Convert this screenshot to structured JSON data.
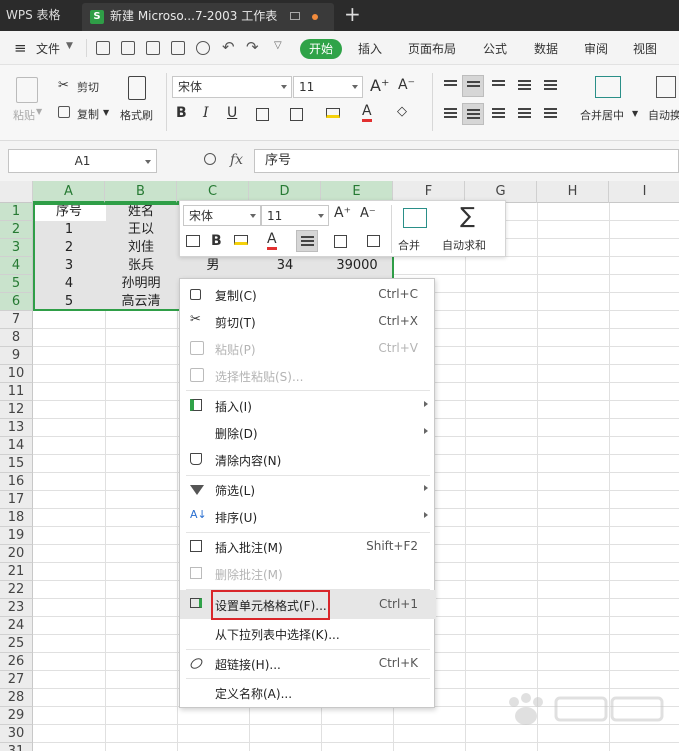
{
  "titlebar": {
    "app_label": "WPS 表格",
    "doc_tab": "新建 Microso...7-2003 工作表",
    "new_tab": "+"
  },
  "menubar": {
    "file": "文件",
    "tabs": [
      "开始",
      "插入",
      "页面布局",
      "公式",
      "数据",
      "审阅",
      "视图"
    ]
  },
  "ribbon": {
    "paste": "粘贴",
    "cut": "剪切",
    "copy": "复制",
    "format_painter": "格式刷",
    "font_name": "宋体",
    "font_size": "11",
    "merge_center": "合并居中",
    "auto_sum": "自动换"
  },
  "formula_bar": {
    "name_box": "A1",
    "fx": "fx",
    "formula": "序号"
  },
  "grid": {
    "columns": [
      "A",
      "B",
      "C",
      "D",
      "E",
      "F",
      "G",
      "H",
      "I"
    ],
    "rows": [
      "1",
      "2",
      "3",
      "4",
      "5",
      "6",
      "7",
      "8",
      "9",
      "10",
      "11",
      "12",
      "13",
      "14",
      "15",
      "16",
      "17",
      "18",
      "19",
      "20",
      "21",
      "22",
      "23",
      "24",
      "25",
      "26",
      "27",
      "28",
      "29",
      "30",
      "31"
    ],
    "cells": {
      "A1": "序号",
      "B1": "姓名",
      "A2": "1",
      "B2": "王以",
      "A3": "2",
      "B3": "刘佳",
      "A4": "3",
      "B4": "张兵",
      "C4": "男",
      "D4": "34",
      "E4": "39000",
      "A5": "4",
      "B5": "孙明明",
      "A6": "5",
      "B6": "高云清"
    }
  },
  "mini_toolbar": {
    "font_name": "宋体",
    "font_size": "11",
    "merge": "合并",
    "auto_sum": "自动求和"
  },
  "context_menu": {
    "items": [
      {
        "label": "复制(C)",
        "shortcut": "Ctrl+C"
      },
      {
        "label": "剪切(T)",
        "shortcut": "Ctrl+X"
      },
      {
        "label": "粘贴(P)",
        "shortcut": "Ctrl+V"
      },
      {
        "label": "选择性粘贴(S)...",
        "shortcut": ""
      },
      {
        "label": "插入(I)",
        "shortcut": ""
      },
      {
        "label": "删除(D)",
        "shortcut": ""
      },
      {
        "label": "清除内容(N)",
        "shortcut": ""
      },
      {
        "label": "筛选(L)",
        "shortcut": ""
      },
      {
        "label": "排序(U)",
        "shortcut": ""
      },
      {
        "label": "插入批注(M)",
        "shortcut": "Shift+F2"
      },
      {
        "label": "删除批注(M)",
        "shortcut": ""
      },
      {
        "label": "设置单元格格式(F)...",
        "shortcut": "Ctrl+1"
      },
      {
        "label": "从下拉列表中选择(K)...",
        "shortcut": ""
      },
      {
        "label": "超链接(H)...",
        "shortcut": "Ctrl+K"
      },
      {
        "label": "定义名称(A)...",
        "shortcut": ""
      }
    ]
  },
  "colors": {
    "accent": "#2fa348",
    "highlight": "#d9262a",
    "titlebar": "#2b2b2b"
  }
}
